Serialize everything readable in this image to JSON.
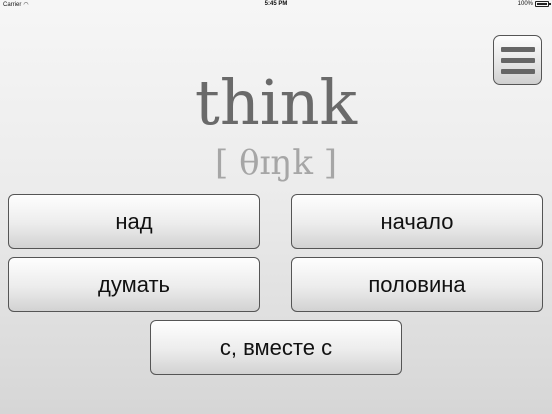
{
  "status_bar": {
    "carrier": "Carrier",
    "time": "5:45 PM",
    "battery": "100%"
  },
  "card": {
    "word": "think",
    "transcription": "[ θɪŋk ]"
  },
  "answers": [
    {
      "label": "над"
    },
    {
      "label": "начало"
    },
    {
      "label": "думать"
    },
    {
      "label": "половина"
    },
    {
      "label": "с, вместе с"
    }
  ],
  "icons": {
    "menu": "hamburger-menu-icon",
    "wifi": "wifi-icon",
    "battery": "battery-icon"
  }
}
